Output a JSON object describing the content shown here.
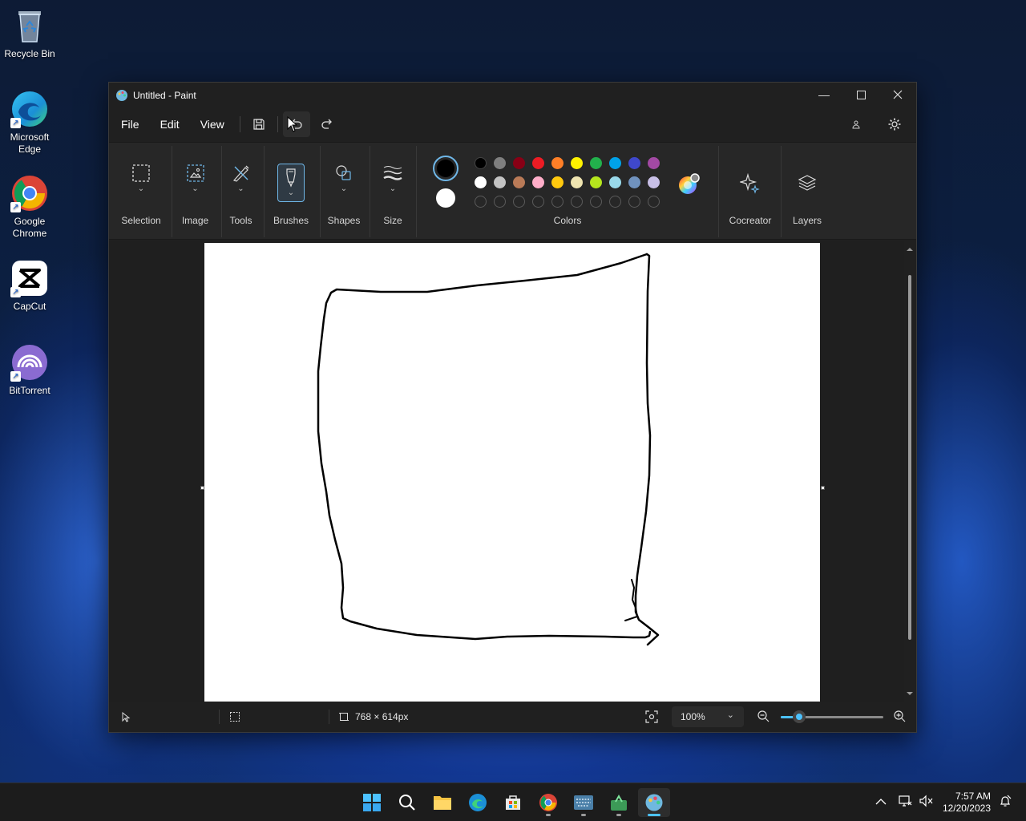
{
  "desktop": {
    "icons": [
      {
        "label": "Recycle Bin",
        "icon": "recycle-bin-icon"
      },
      {
        "label": "Microsoft Edge",
        "icon": "edge-icon"
      },
      {
        "label": "Google Chrome",
        "icon": "chrome-icon"
      },
      {
        "label": "CapCut",
        "icon": "capcut-icon"
      },
      {
        "label": "BitTorrent",
        "icon": "bittorrent-icon"
      }
    ]
  },
  "window": {
    "title": "Untitled - Paint",
    "controls": [
      "minimize",
      "maximize",
      "close"
    ]
  },
  "menubar": {
    "file": "File",
    "edit": "Edit",
    "view": "View"
  },
  "ribbon": {
    "selection": "Selection",
    "image": "Image",
    "tools": "Tools",
    "brushes": "Brushes",
    "shapes": "Shapes",
    "size": "Size",
    "colors": "Colors",
    "cocreator": "Cocreator",
    "layers": "Layers",
    "primary_color": "#000000",
    "secondary_color": "#ffffff",
    "palette_row1": [
      "#000000",
      "#7f7f7f",
      "#880015",
      "#ed1c24",
      "#ff7f27",
      "#fff200",
      "#22b14c",
      "#00a2e8",
      "#3f48cc",
      "#a349a4"
    ],
    "palette_row2": [
      "#ffffff",
      "#c3c3c3",
      "#b97a57",
      "#ffaec9",
      "#ffc90e",
      "#efe4b0",
      "#b5e61d",
      "#99d9ea",
      "#7092be",
      "#c8bfe7"
    ],
    "palette_row3_count": 10
  },
  "statusbar": {
    "canvas_size": "768 × 614px",
    "zoom": "100%",
    "zoom_fraction": 0.18
  },
  "taskbar": {
    "apps": [
      "start-icon",
      "search-icon",
      "file-explorer-icon",
      "edge-icon",
      "store-icon",
      "chrome-icon",
      "keyboard-app-icon",
      "green-app-icon",
      "paint-icon"
    ],
    "time": "7:57 AM",
    "date": "12/20/2023"
  }
}
